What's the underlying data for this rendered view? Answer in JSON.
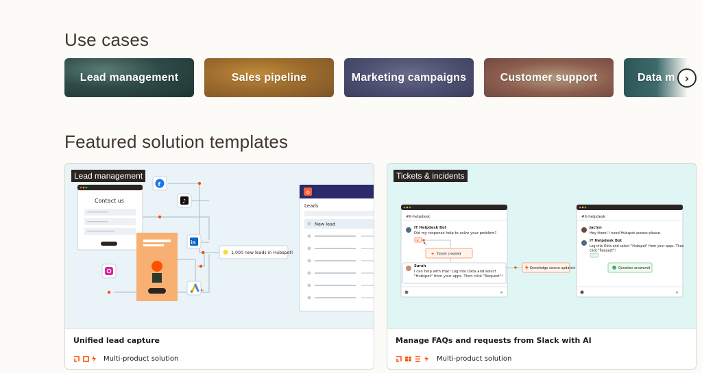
{
  "use_cases": {
    "title": "Use cases",
    "items": [
      {
        "label": "Lead management"
      },
      {
        "label": "Sales pipeline"
      },
      {
        "label": "Marketing campaigns"
      },
      {
        "label": "Customer support"
      },
      {
        "label": "Data m"
      }
    ]
  },
  "featured": {
    "title": "Featured solution templates",
    "cards": [
      {
        "badge": "Lead management",
        "title": "Unified lead capture",
        "subtitle": "Multi-product solution",
        "art": {
          "form_title": "Contact us",
          "notification": "1,000 new leads in Hubspot!",
          "crm_header": "Leads",
          "crm_first_row": "New lead",
          "app_icons": [
            "facebook-icon",
            "tiktok-icon",
            "linkedin-icon",
            "instagram-icon",
            "google-ads-icon",
            "hubspot-icon"
          ]
        }
      },
      {
        "badge": "Tickets & incidents",
        "title": "Manage FAQs and requests from Slack with AI",
        "subtitle": "Multi-product solution",
        "art": {
          "channel": "#it-helpdesk",
          "bot_name": "IT Helpdesk Bot",
          "bot_question": "Did my response help to solve your problem?",
          "ticket_created": "Ticket created",
          "user_name": "Sarah",
          "user_message_1": "I can help with that! Log into Okta and select",
          "user_message_2": "\"Hubspot\" from your apps. Then click \"Request\"!",
          "knowledge_updated": "Knowledge source updated",
          "right_channel": "#it-helpdesk",
          "user2_name": "Jaclyn",
          "user2_message": "Hey there! I need Hubspot access please.",
          "bot2_name": "IT Helpdesk Bot",
          "bot2_message_1": "Log into Okta and select \"Hubspot\" from your apps. Then",
          "bot2_message_2": "click \"Request\"!",
          "question_answered": "Question answered"
        }
      }
    ]
  },
  "colors": {
    "accent_orange": "#ff4f00",
    "badge_bg": "#2b2522"
  }
}
